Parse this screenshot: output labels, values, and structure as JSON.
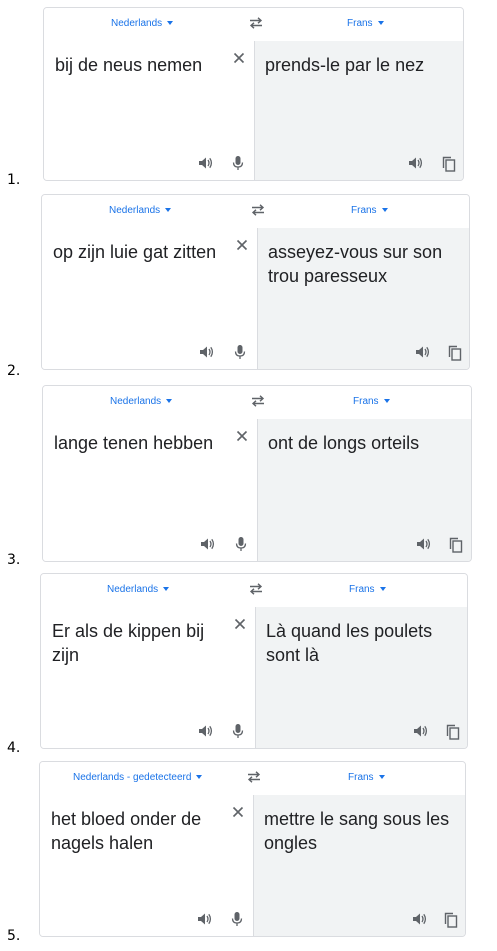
{
  "items": [
    {
      "num": "1.",
      "source_lang": "Nederlands",
      "target_lang": "Frans",
      "source_text": "bij de neus nemen",
      "target_text": "prends-le par le nez"
    },
    {
      "num": "2.",
      "source_lang": "Nederlands",
      "target_lang": "Frans",
      "source_text": "op zijn luie gat zitten",
      "target_text": "asseyez-vous sur son trou paresseux"
    },
    {
      "num": "3.",
      "source_lang": "Nederlands",
      "target_lang": "Frans",
      "source_text": "lange tenen hebben",
      "target_text": "ont de longs orteils"
    },
    {
      "num": "4.",
      "source_lang": "Nederlands",
      "target_lang": "Frans",
      "source_text": "Er als de kippen bij zijn",
      "target_text": "Là quand les poulets sont là"
    },
    {
      "num": "5.",
      "source_lang": "Nederlands - gedetecteerd",
      "target_lang": "Frans",
      "source_text": "het bloed onder de nagels halen",
      "target_text": "mettre le sang sous les ongles"
    }
  ],
  "icons": {
    "swap": "swap-arrows-icon",
    "clear": "close-icon",
    "listen": "speaker-icon",
    "voice": "microphone-icon",
    "copy": "copy-icon"
  },
  "colors": {
    "accent": "#1a73e8",
    "border": "#dadce0",
    "target_bg": "#f1f3f4",
    "icon": "#5f6368",
    "text": "#202124"
  }
}
